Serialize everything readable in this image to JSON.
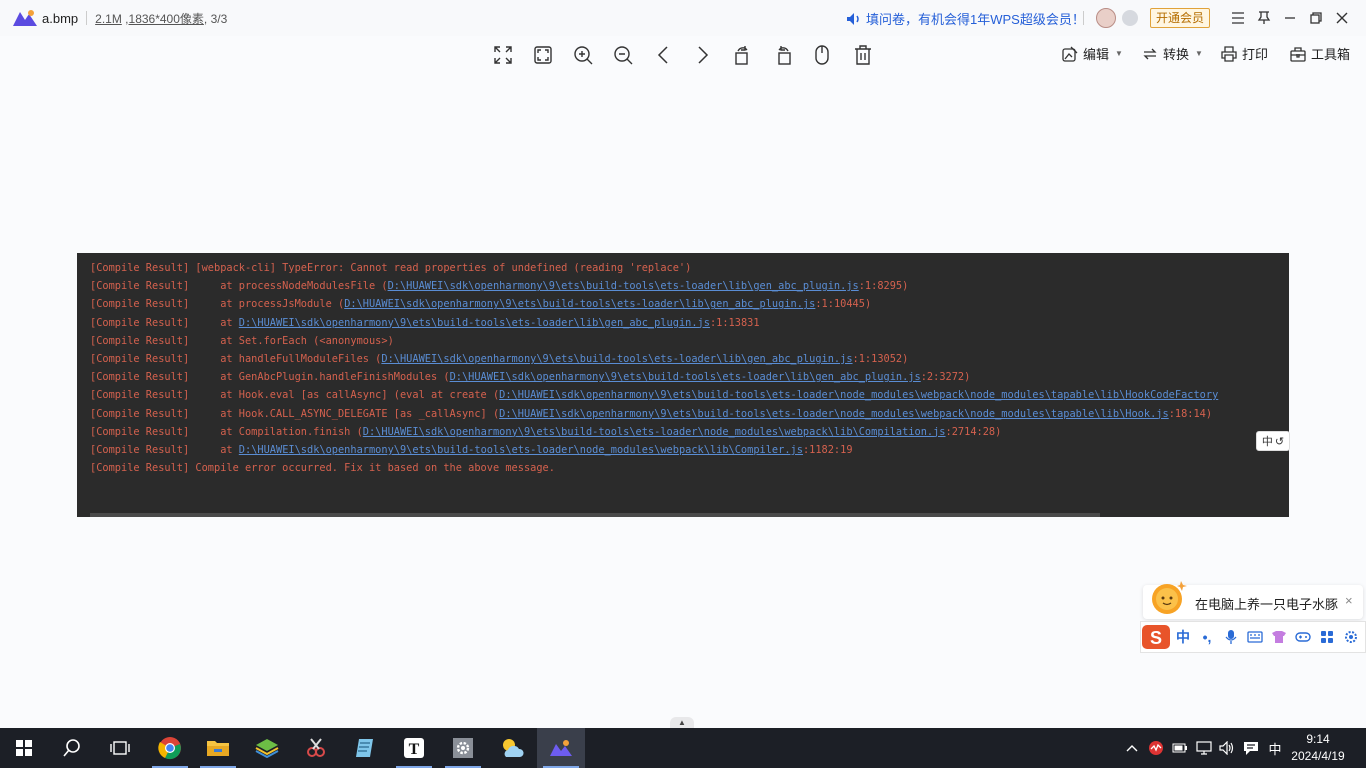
{
  "titlebar": {
    "file_name": "a.bmp",
    "file_size": "2.1M",
    "dimensions": "1836*400像素",
    "page_indicator": "3/3",
    "promo_text": "填问卷，有机会得1年WPS超级会员！",
    "vip_button": "开通会员"
  },
  "toolbar": {
    "edit_label": "编辑",
    "convert_label": "转换",
    "print_label": "打印",
    "toolbox_label": "工具箱"
  },
  "console": {
    "lines": [
      {
        "prefix": "[Compile Result] ",
        "text": "[webpack-cli] TypeError: Cannot read properties of undefined (reading 'replace')",
        "link": "",
        "suffix": ""
      },
      {
        "prefix": "[Compile Result]     ",
        "text": "at processNodeModulesFile (",
        "link": "D:\\HUAWEI\\sdk\\openharmony\\9\\ets\\build-tools\\ets-loader\\lib\\gen_abc_plugin.js",
        "suffix": ":1:8295)"
      },
      {
        "prefix": "[Compile Result]     ",
        "text": "at processJsModule (",
        "link": "D:\\HUAWEI\\sdk\\openharmony\\9\\ets\\build-tools\\ets-loader\\lib\\gen_abc_plugin.js",
        "suffix": ":1:10445)"
      },
      {
        "prefix": "[Compile Result]     ",
        "text": "at ",
        "link": "D:\\HUAWEI\\sdk\\openharmony\\9\\ets\\build-tools\\ets-loader\\lib\\gen_abc_plugin.js",
        "suffix": ":1:13831"
      },
      {
        "prefix": "[Compile Result]     ",
        "text": "at Set.forEach (<anonymous>)",
        "link": "",
        "suffix": ""
      },
      {
        "prefix": "[Compile Result]     ",
        "text": "at handleFullModuleFiles (",
        "link": "D:\\HUAWEI\\sdk\\openharmony\\9\\ets\\build-tools\\ets-loader\\lib\\gen_abc_plugin.js",
        "suffix": ":1:13052)"
      },
      {
        "prefix": "[Compile Result]     ",
        "text": "at GenAbcPlugin.handleFinishModules (",
        "link": "D:\\HUAWEI\\sdk\\openharmony\\9\\ets\\build-tools\\ets-loader\\lib\\gen_abc_plugin.js",
        "suffix": ":2:3272)"
      },
      {
        "prefix": "[Compile Result]     ",
        "text": "at Hook.eval [as callAsync] (eval at create (",
        "link": "D:\\HUAWEI\\sdk\\openharmony\\9\\ets\\build-tools\\ets-loader\\node_modules\\webpack\\node_modules\\tapable\\lib\\HookCodeFactory",
        "suffix": ""
      },
      {
        "prefix": "[Compile Result]     ",
        "text": "at Hook.CALL_ASYNC_DELEGATE [as _callAsync] (",
        "link": "D:\\HUAWEI\\sdk\\openharmony\\9\\ets\\build-tools\\ets-loader\\node_modules\\webpack\\node_modules\\tapable\\lib\\Hook.js",
        "suffix": ":18:14)"
      },
      {
        "prefix": "[Compile Result]     ",
        "text": "at Compilation.finish (",
        "link": "D:\\HUAWEI\\sdk\\openharmony\\9\\ets\\build-tools\\ets-loader\\node_modules\\webpack\\lib\\Compilation.js",
        "suffix": ":2714:28)"
      },
      {
        "prefix": "[Compile Result]     ",
        "text": "at ",
        "link": "D:\\HUAWEI\\sdk\\openharmony\\9\\ets\\build-tools\\ets-loader\\node_modules\\webpack\\lib\\Compiler.js",
        "suffix": ":1182:19"
      },
      {
        "prefix": "[Compile Result] ",
        "text": "Compile error occurred. Fix it based on the above message.",
        "link": "",
        "suffix": ""
      }
    ],
    "chip_label": "中"
  },
  "ime": {
    "tip_text": "在电脑上养一只电子水豚",
    "close_glyph": "×",
    "mode_label": "中",
    "punct_label": "•,"
  },
  "taskbar": {
    "tray_lang": "中",
    "time": "9:14",
    "date": "2024/4/19"
  },
  "colors": {
    "accent_blue": "#2660d8",
    "console_bg": "#2b2b2b",
    "console_text": "#d4614e",
    "console_link": "#5a8dd4",
    "taskbar_bg": "#1c1f26"
  }
}
